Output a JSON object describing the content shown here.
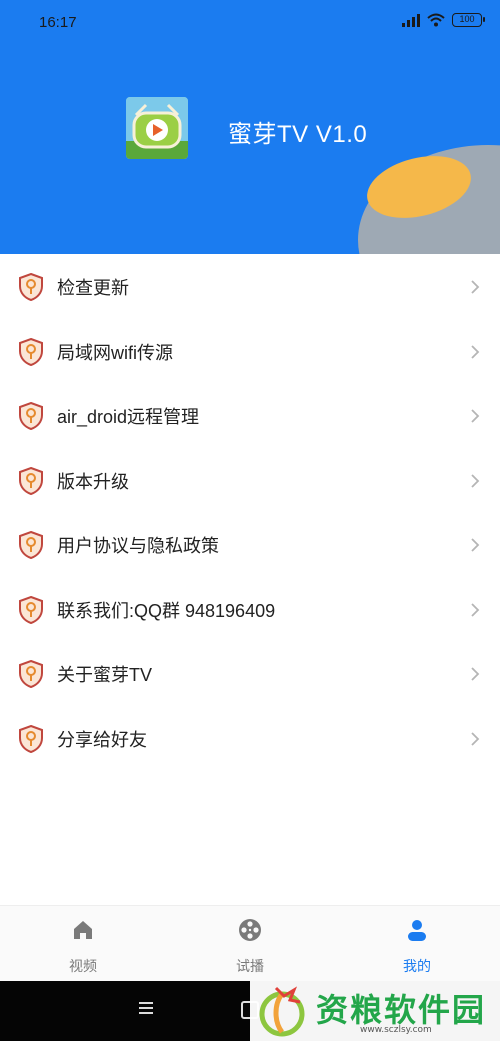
{
  "status_bar": {
    "time": "16:17",
    "network": "4G",
    "battery": "100"
  },
  "header": {
    "app_name": "蜜芽TV V1.0",
    "colors": {
      "background": "#1b7cf0",
      "blob_gray": "#9ea9b4",
      "blob_yellow": "#f5b84a"
    }
  },
  "menu": {
    "items": [
      {
        "label": "检查更新",
        "icon": "shield-key-icon"
      },
      {
        "label": "局域网wifi传源",
        "icon": "shield-key-icon"
      },
      {
        "label": "air_droid远程管理",
        "icon": "shield-key-icon"
      },
      {
        "label": "版本升级",
        "icon": "shield-key-icon"
      },
      {
        "label": "用户协议与隐私政策",
        "icon": "shield-key-icon"
      },
      {
        "label": "联系我们:QQ群 948196409",
        "icon": "shield-key-icon"
      },
      {
        "label": "关于蜜芽TV",
        "icon": "shield-key-icon"
      },
      {
        "label": "分享给好友",
        "icon": "shield-key-icon"
      }
    ]
  },
  "bottom_nav": {
    "active_index": 2,
    "items": [
      {
        "label": "视频",
        "icon": "home-icon"
      },
      {
        "label": "试播",
        "icon": "film-reel-icon"
      },
      {
        "label": "我的",
        "icon": "user-icon"
      }
    ],
    "colors": {
      "active": "#1b7cf0",
      "inactive": "#7a7a7a"
    }
  },
  "watermark": {
    "text": "资粮软件园",
    "url": "www.sczlsy.com",
    "color": "#23a64a"
  }
}
